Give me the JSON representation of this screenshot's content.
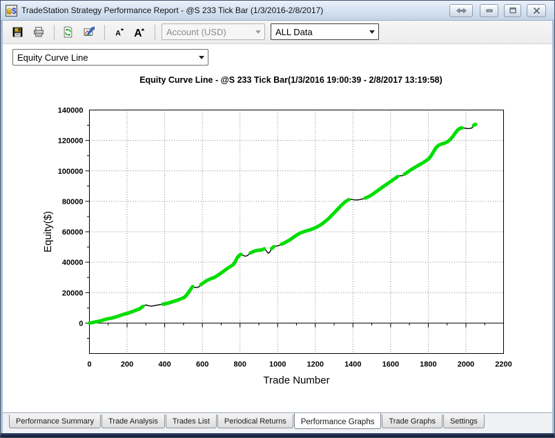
{
  "window": {
    "title": "TradeStation Strategy Performance Report - @S 233 Tick Bar (1/3/2016-2/8/2017)",
    "controls": [
      {
        "name": "resize-horizontal-button",
        "icon": "resize-horizontal-icon"
      },
      {
        "name": "minimize-button",
        "icon": "minimize-icon"
      },
      {
        "name": "restore-button",
        "icon": "restore-icon"
      },
      {
        "name": "close-button",
        "icon": "close-icon"
      }
    ]
  },
  "toolbar": {
    "buttons": [
      {
        "icon": "save-icon"
      },
      {
        "icon": "print-icon"
      },
      {
        "sep": true
      },
      {
        "icon": "refresh-icon"
      },
      {
        "icon": "report-settings-icon"
      },
      {
        "sep": true
      },
      {
        "icon": "font-decrease-icon"
      },
      {
        "icon": "font-increase-icon"
      },
      {
        "sep": true
      },
      {
        "sep": true
      }
    ],
    "account_combo": {
      "value": "Account (USD)",
      "enabled": false
    },
    "data_combo": {
      "value": "ALL Data",
      "enabled": true
    }
  },
  "graph_selector": {
    "value": "Equity Curve Line"
  },
  "tabs": {
    "items": [
      "Performance Summary",
      "Trade Analysis",
      "Trades List",
      "Periodical Returns",
      "Performance Graphs",
      "Trade Graphs",
      "Settings"
    ],
    "active_index": 4
  },
  "chart_data": {
    "type": "line",
    "title": "Equity Curve Line - @S 233 Tick Bar(1/3/2016 19:00:39 - 2/8/2017 13:19:58)",
    "xlabel": "Trade Number",
    "ylabel": "Equity($)",
    "xlim": [
      0,
      2200
    ],
    "ylim": [
      -20000,
      140000
    ],
    "x_ticks": [
      0,
      200,
      400,
      600,
      800,
      1000,
      1200,
      1400,
      1600,
      1800,
      2000,
      2200
    ],
    "y_ticks": [
      0,
      20000,
      40000,
      60000,
      80000,
      100000,
      120000,
      140000
    ],
    "x_minor_step": 100,
    "y_minor_step": 10000,
    "grid": "dotted",
    "legend": "none",
    "series": [
      {
        "name": "Equity",
        "color": "#00dd00",
        "drawdown_color": "#000000",
        "points": [
          [
            0,
            0
          ],
          [
            30,
            700
          ],
          [
            60,
            1500
          ],
          [
            90,
            2600
          ],
          [
            120,
            3300
          ],
          [
            150,
            4400
          ],
          [
            180,
            5700
          ],
          [
            210,
            6700
          ],
          [
            240,
            8100
          ],
          [
            265,
            9300
          ],
          [
            285,
            11000
          ],
          [
            300,
            11900
          ],
          [
            315,
            11400
          ],
          [
            330,
            11100
          ],
          [
            345,
            11500
          ],
          [
            360,
            11800
          ],
          [
            390,
            12400
          ],
          [
            420,
            13200
          ],
          [
            450,
            14300
          ],
          [
            480,
            15600
          ],
          [
            505,
            16900
          ],
          [
            520,
            19000
          ],
          [
            535,
            21700
          ],
          [
            548,
            24000
          ],
          [
            558,
            23500
          ],
          [
            570,
            23400
          ],
          [
            582,
            23800
          ],
          [
            592,
            25300
          ],
          [
            605,
            26400
          ],
          [
            620,
            27700
          ],
          [
            635,
            28600
          ],
          [
            650,
            29400
          ],
          [
            665,
            30100
          ],
          [
            680,
            31200
          ],
          [
            695,
            32500
          ],
          [
            712,
            34000
          ],
          [
            725,
            35200
          ],
          [
            738,
            36300
          ],
          [
            752,
            37400
          ],
          [
            765,
            38500
          ],
          [
            775,
            40400
          ],
          [
            785,
            42900
          ],
          [
            795,
            44300
          ],
          [
            805,
            45200
          ],
          [
            815,
            44600
          ],
          [
            828,
            43900
          ],
          [
            840,
            44400
          ],
          [
            855,
            46100
          ],
          [
            870,
            47000
          ],
          [
            885,
            47600
          ],
          [
            900,
            47900
          ],
          [
            915,
            48100
          ],
          [
            930,
            48800
          ],
          [
            940,
            47400
          ],
          [
            950,
            45900
          ],
          [
            958,
            46600
          ],
          [
            968,
            49000
          ],
          [
            980,
            50200
          ],
          [
            995,
            50700
          ],
          [
            1008,
            51000
          ],
          [
            1020,
            51800
          ],
          [
            1035,
            52600
          ],
          [
            1050,
            53700
          ],
          [
            1065,
            54700
          ],
          [
            1080,
            56000
          ],
          [
            1100,
            57800
          ],
          [
            1120,
            59200
          ],
          [
            1145,
            60300
          ],
          [
            1170,
            61200
          ],
          [
            1195,
            62300
          ],
          [
            1220,
            63900
          ],
          [
            1245,
            66000
          ],
          [
            1270,
            68600
          ],
          [
            1295,
            71800
          ],
          [
            1320,
            75000
          ],
          [
            1340,
            77600
          ],
          [
            1360,
            79800
          ],
          [
            1378,
            81100
          ],
          [
            1392,
            81300
          ],
          [
            1405,
            81000
          ],
          [
            1420,
            80900
          ],
          [
            1435,
            81100
          ],
          [
            1450,
            81500
          ],
          [
            1465,
            82100
          ],
          [
            1480,
            82900
          ],
          [
            1500,
            84300
          ],
          [
            1520,
            86000
          ],
          [
            1540,
            87800
          ],
          [
            1560,
            89600
          ],
          [
            1580,
            91300
          ],
          [
            1600,
            93000
          ],
          [
            1620,
            94700
          ],
          [
            1638,
            96300
          ],
          [
            1650,
            96900
          ],
          [
            1660,
            96700
          ],
          [
            1672,
            97700
          ],
          [
            1688,
            99000
          ],
          [
            1705,
            100500
          ],
          [
            1725,
            102000
          ],
          [
            1748,
            103700
          ],
          [
            1770,
            105200
          ],
          [
            1790,
            106800
          ],
          [
            1805,
            108200
          ],
          [
            1815,
            109900
          ],
          [
            1828,
            112600
          ],
          [
            1842,
            115400
          ],
          [
            1856,
            116900
          ],
          [
            1872,
            117700
          ],
          [
            1888,
            118300
          ],
          [
            1902,
            119100
          ],
          [
            1916,
            120500
          ],
          [
            1930,
            122600
          ],
          [
            1944,
            125000
          ],
          [
            1956,
            126900
          ],
          [
            1968,
            127900
          ],
          [
            1980,
            128300
          ],
          [
            1993,
            128100
          ],
          [
            2008,
            127800
          ],
          [
            2022,
            127900
          ],
          [
            2032,
            128200
          ],
          [
            2040,
            129800
          ],
          [
            2046,
            130400
          ],
          [
            2052,
            130600
          ]
        ],
        "drawdown_spans": [
          [
            293,
            362
          ],
          [
            552,
            588
          ],
          [
            810,
            845
          ],
          [
            934,
            962
          ],
          [
            990,
            1012
          ],
          [
            1388,
            1452
          ],
          [
            1645,
            1668
          ],
          [
            1986,
            2036
          ]
        ]
      }
    ]
  }
}
